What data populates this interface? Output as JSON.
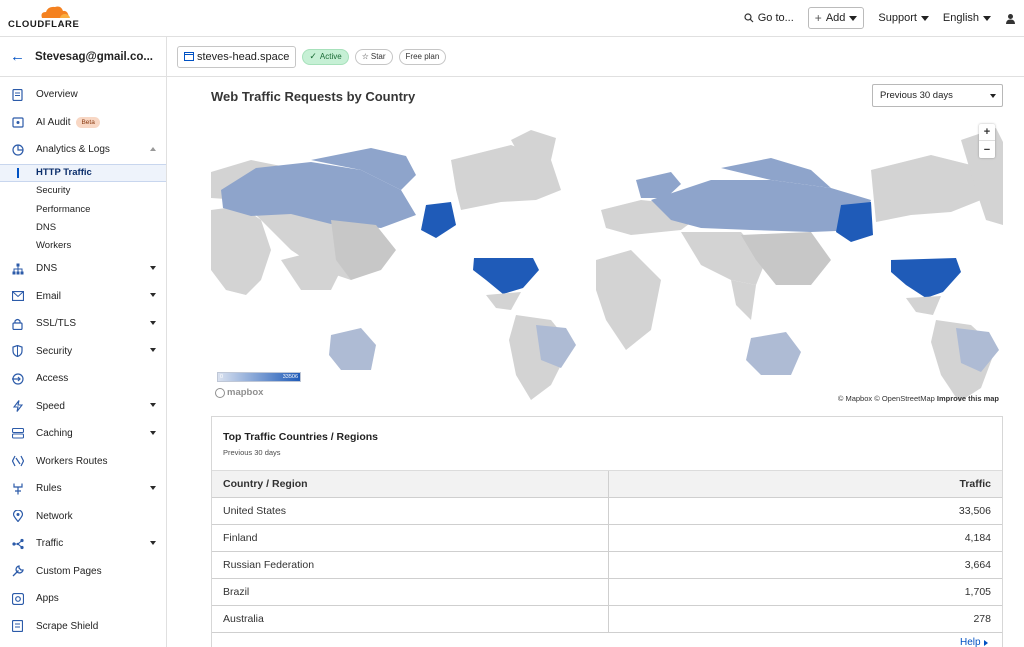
{
  "topbar": {
    "brand": "CLOUDFLARE",
    "goto": "Go to...",
    "add": "Add",
    "support": "Support",
    "language": "English"
  },
  "account": {
    "name": "Stevesag@gmail.co..."
  },
  "sidebar": {
    "items": [
      {
        "label": "Overview",
        "icon": "document-icon"
      },
      {
        "label": "AI Audit",
        "icon": "ai-audit-icon",
        "badge": "Beta"
      },
      {
        "label": "Analytics & Logs",
        "icon": "chart-pie-icon",
        "expanded": true,
        "children": [
          "HTTP Traffic",
          "Security",
          "Performance",
          "DNS",
          "Workers"
        ]
      },
      {
        "label": "DNS",
        "icon": "network-tree-icon"
      },
      {
        "label": "Email",
        "icon": "email-icon"
      },
      {
        "label": "SSL/TLS",
        "icon": "lock-icon"
      },
      {
        "label": "Security",
        "icon": "shield-icon"
      },
      {
        "label": "Access",
        "icon": "access-icon"
      },
      {
        "label": "Speed",
        "icon": "lightning-icon"
      },
      {
        "label": "Caching",
        "icon": "server-icon"
      },
      {
        "label": "Workers Routes",
        "icon": "workers-icon"
      },
      {
        "label": "Rules",
        "icon": "rules-icon"
      },
      {
        "label": "Network",
        "icon": "location-pin-icon"
      },
      {
        "label": "Traffic",
        "icon": "traffic-icon"
      },
      {
        "label": "Custom Pages",
        "icon": "wrench-icon"
      },
      {
        "label": "Apps",
        "icon": "apps-icon"
      },
      {
        "label": "Scrape Shield",
        "icon": "scrape-shield-icon"
      }
    ],
    "active_child": "HTTP Traffic"
  },
  "zone": {
    "domain": "steves-head.space",
    "status": "Active",
    "star": "Star",
    "plan": "Free plan"
  },
  "main": {
    "title": "Web Traffic Requests by Country",
    "period_select": "Previous 30 days",
    "map": {
      "zoom_in": "+",
      "zoom_out": "−",
      "legend_min": "0",
      "legend_max": "33506",
      "mapbox": "mapbox",
      "attribution_1": "© Mapbox",
      "attribution_2": "© OpenStreetMap",
      "attribution_3": "Improve this map",
      "colors": {
        "high": "#1f5bb8",
        "mid": "#8ea4cb",
        "low": "#aebbd4",
        "none": "#d3d3d3"
      }
    },
    "table": {
      "title": "Top Traffic Countries / Regions",
      "subtitle": "Previous 30 days",
      "columns": [
        "Country / Region",
        "Traffic"
      ],
      "rows": [
        [
          "United States",
          "33,506"
        ],
        [
          "Finland",
          "4,184"
        ],
        [
          "Russian Federation",
          "3,664"
        ],
        [
          "Brazil",
          "1,705"
        ],
        [
          "Australia",
          "278"
        ]
      ]
    },
    "help": "Help"
  }
}
